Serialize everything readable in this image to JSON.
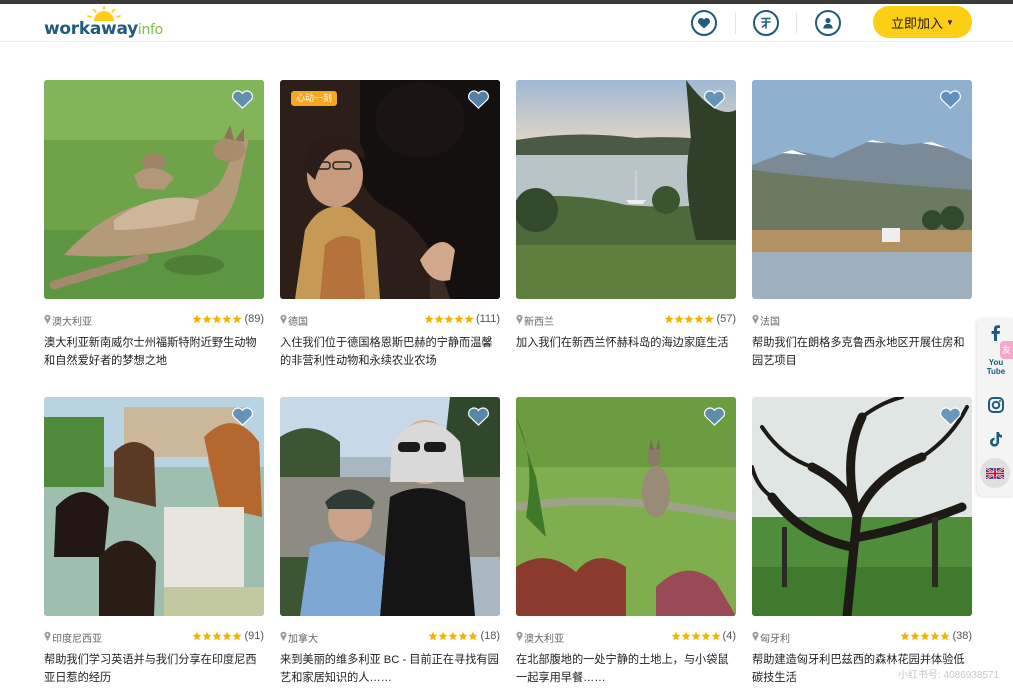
{
  "header": {
    "logo": {
      "brand": "workaway",
      "suffix": "info"
    },
    "join_label": "立即加入",
    "icons": [
      "heart-icon",
      "currency-icon",
      "user-icon"
    ]
  },
  "colors": {
    "brand_blue": "#1f5b7a",
    "brand_green": "#7cc243",
    "join_yellow": "#fccf14",
    "star_gold": "#f5b301",
    "fav_blue": "#5b8db8"
  },
  "listings": [
    {
      "country": "澳大利亚",
      "rating_count": "(89)",
      "stars": 5,
      "title": "澳大利亚新南威尔士州福斯特附近野生动物和自然爱好者的梦想之地"
    },
    {
      "badge": "心动一刻",
      "country": "德国",
      "rating_count": "(111)",
      "stars": 5,
      "title": "入住我们位于德国格恩斯巴赫的宁静而温馨的非营利性动物和永续农业农场"
    },
    {
      "country": "新西兰",
      "rating_count": "(57)",
      "stars": 5,
      "title": "加入我们在新西兰怀赫科岛的海边家庭生活"
    },
    {
      "country": "法国",
      "rating_count": "",
      "stars": 0,
      "title": "帮助我们在朗格多克鲁西永地区开展住房和园艺项目"
    },
    {
      "country": "印度尼西亚",
      "rating_count": "(91)",
      "stars": 5,
      "title": "帮助我们学习英语并与我们分享在印度尼西亚日惹的经历"
    },
    {
      "country": "加拿大",
      "rating_count": "(18)",
      "stars": 5,
      "title": "来到美丽的维多利亚 BC - 目前正在寻找有园艺和家居知识的人……"
    },
    {
      "country": "澳大利亚",
      "rating_count": "(4)",
      "stars": 5,
      "title": "在北部腹地的一处宁静的土地上，与小袋鼠一起享用早餐……"
    },
    {
      "country": "匈牙利",
      "rating_count": "(38)",
      "stars": 5,
      "title": "帮助建造匈牙利巴兹西的森林花园并体验低碳技生活"
    }
  ],
  "side_dock": {
    "icons": [
      "facebook-icon",
      "youtube-icon",
      "instagram-icon",
      "tiktok-icon",
      "uk-flag-icon"
    ],
    "youtube_label": "You Tube",
    "tab_label": "友"
  },
  "watermark": "小红书号: 4086938571"
}
